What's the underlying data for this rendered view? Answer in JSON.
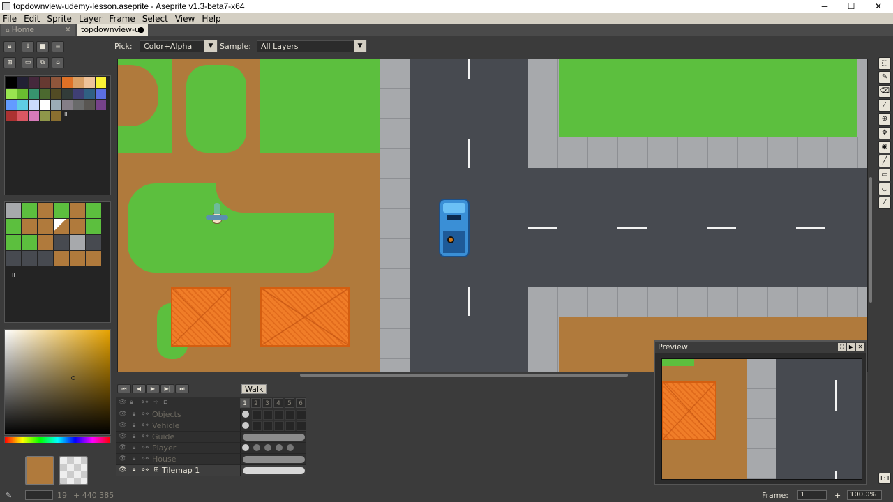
{
  "window": {
    "title": "topdownview-udemy-lesson.aseprite - Aseprite v1.3-beta7-x64",
    "minimize": "─",
    "maximize": "☐",
    "close": "✕"
  },
  "menu": [
    "File",
    "Edit",
    "Sprite",
    "Layer",
    "Frame",
    "Select",
    "View",
    "Help"
  ],
  "tabs": {
    "home": "Home",
    "home_close": "✕",
    "doc": "topdownview-u",
    "doc_modified": "●"
  },
  "options": {
    "pick_label": "Pick:",
    "pick_value": "Color+Alpha",
    "sample_label": "Sample:",
    "sample_value": "All Layers"
  },
  "palette": {
    "colors": [
      "#000000",
      "#222034",
      "#45283c",
      "#663931",
      "#8f563b",
      "#df7126",
      "#d9a066",
      "#eec39a",
      "#fbf236",
      "#99e550",
      "#6abe30",
      "#37946e",
      "#4b692f",
      "#524b24",
      "#323c39",
      "#3f3f74",
      "#306082",
      "#5b6ee1",
      "#639bff",
      "#5fcde4",
      "#cbdbfc",
      "#ffffff",
      "#9badb7",
      "#847e87",
      "#696a6a",
      "#595652",
      "#76428a",
      "#ac3232",
      "#d95763",
      "#d77bba",
      "#8f974a",
      "#8a6f30"
    ],
    "more_marker": "II"
  },
  "tileset_marker": "II",
  "canvas_view": {
    "pick_desc": "topdown scene"
  },
  "timeline": {
    "tag": "Walk",
    "frames": [
      "1",
      "2",
      "3",
      "4",
      "5",
      "6"
    ],
    "layers": [
      {
        "name": "Objects",
        "kind": "dot"
      },
      {
        "name": "Vehicle",
        "kind": "dot"
      },
      {
        "name": "Guide",
        "kind": "bar"
      },
      {
        "name": "Player",
        "kind": "dots"
      },
      {
        "name": "House",
        "kind": "bar"
      },
      {
        "name": "Tilemap 1",
        "kind": "barbright"
      }
    ]
  },
  "preview": {
    "title": "Preview"
  },
  "status": {
    "brush_size": "19",
    "coords": "+ 440 385",
    "frame_label": "Frame:",
    "frame_value": "1",
    "zoom": "100.0%",
    "zoom_plus": "+"
  },
  "colors": {
    "grass": "#5cbf3e",
    "dirt": "#b07a3c",
    "road": "#474a50",
    "sidewalk": "#a7a9ac",
    "roof": "#f07d28",
    "vehicle": "#3a8fd6"
  }
}
